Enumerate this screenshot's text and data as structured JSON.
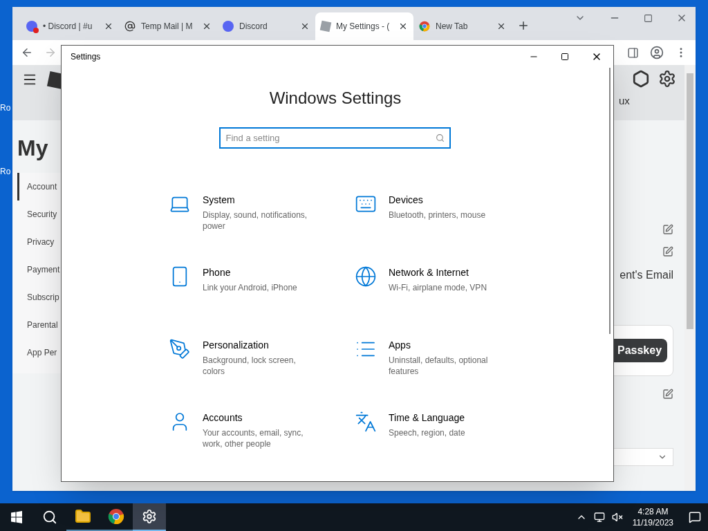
{
  "desktop_icons": [
    {
      "label": "Ro"
    },
    {
      "label": "Ro"
    }
  ],
  "browser": {
    "tabs": [
      {
        "kind": "discord-alert",
        "title": "• Discord | #u",
        "selected": false
      },
      {
        "kind": "mail",
        "title": "Temp Mail | M",
        "selected": false
      },
      {
        "kind": "discord",
        "title": "Discord",
        "selected": false
      },
      {
        "kind": "roblox",
        "title": "My Settings - (",
        "selected": true
      },
      {
        "kind": "chrome",
        "title": "New Tab",
        "selected": false
      }
    ],
    "page": {
      "header_text": "ux",
      "title": "My",
      "nav": [
        {
          "label": "Account",
          "selected": true
        },
        {
          "label": "Security",
          "selected": false
        },
        {
          "label": "Privacy",
          "selected": false
        },
        {
          "label": "Payment",
          "selected": false
        },
        {
          "label": "Subscrip",
          "selected": false
        },
        {
          "label": "Parental",
          "selected": false
        },
        {
          "label": "App Per",
          "selected": false
        }
      ],
      "email_text": "ent's Email",
      "button": "Passkey"
    }
  },
  "settings_window": {
    "title": "Settings",
    "heading": "Windows Settings",
    "search": {
      "placeholder": "Find a setting"
    },
    "categories": [
      {
        "kind": "system",
        "name": "System",
        "description": "Display, sound, notifications, power"
      },
      {
        "kind": "devices",
        "name": "Devices",
        "description": "Bluetooth, printers, mouse"
      },
      {
        "kind": "phone",
        "name": "Phone",
        "description": "Link your Android, iPhone"
      },
      {
        "kind": "network",
        "name": "Network & Internet",
        "description": "Wi-Fi, airplane mode, VPN"
      },
      {
        "kind": "personalization",
        "name": "Personalization",
        "description": "Background, lock screen, colors"
      },
      {
        "kind": "apps",
        "name": "Apps",
        "description": "Uninstall, defaults, optional features"
      },
      {
        "kind": "accounts",
        "name": "Accounts",
        "description": "Your accounts, email, sync, work, other people"
      },
      {
        "kind": "time",
        "name": "Time & Language",
        "description": "Speech, region, date"
      }
    ]
  },
  "taskbar": {
    "apps": [
      {
        "kind": "explorer",
        "selected": false
      },
      {
        "kind": "chrome",
        "selected": false
      },
      {
        "kind": "settings",
        "selected": true
      }
    ],
    "time": "4:28 AM",
    "date": "11/19/2023"
  }
}
